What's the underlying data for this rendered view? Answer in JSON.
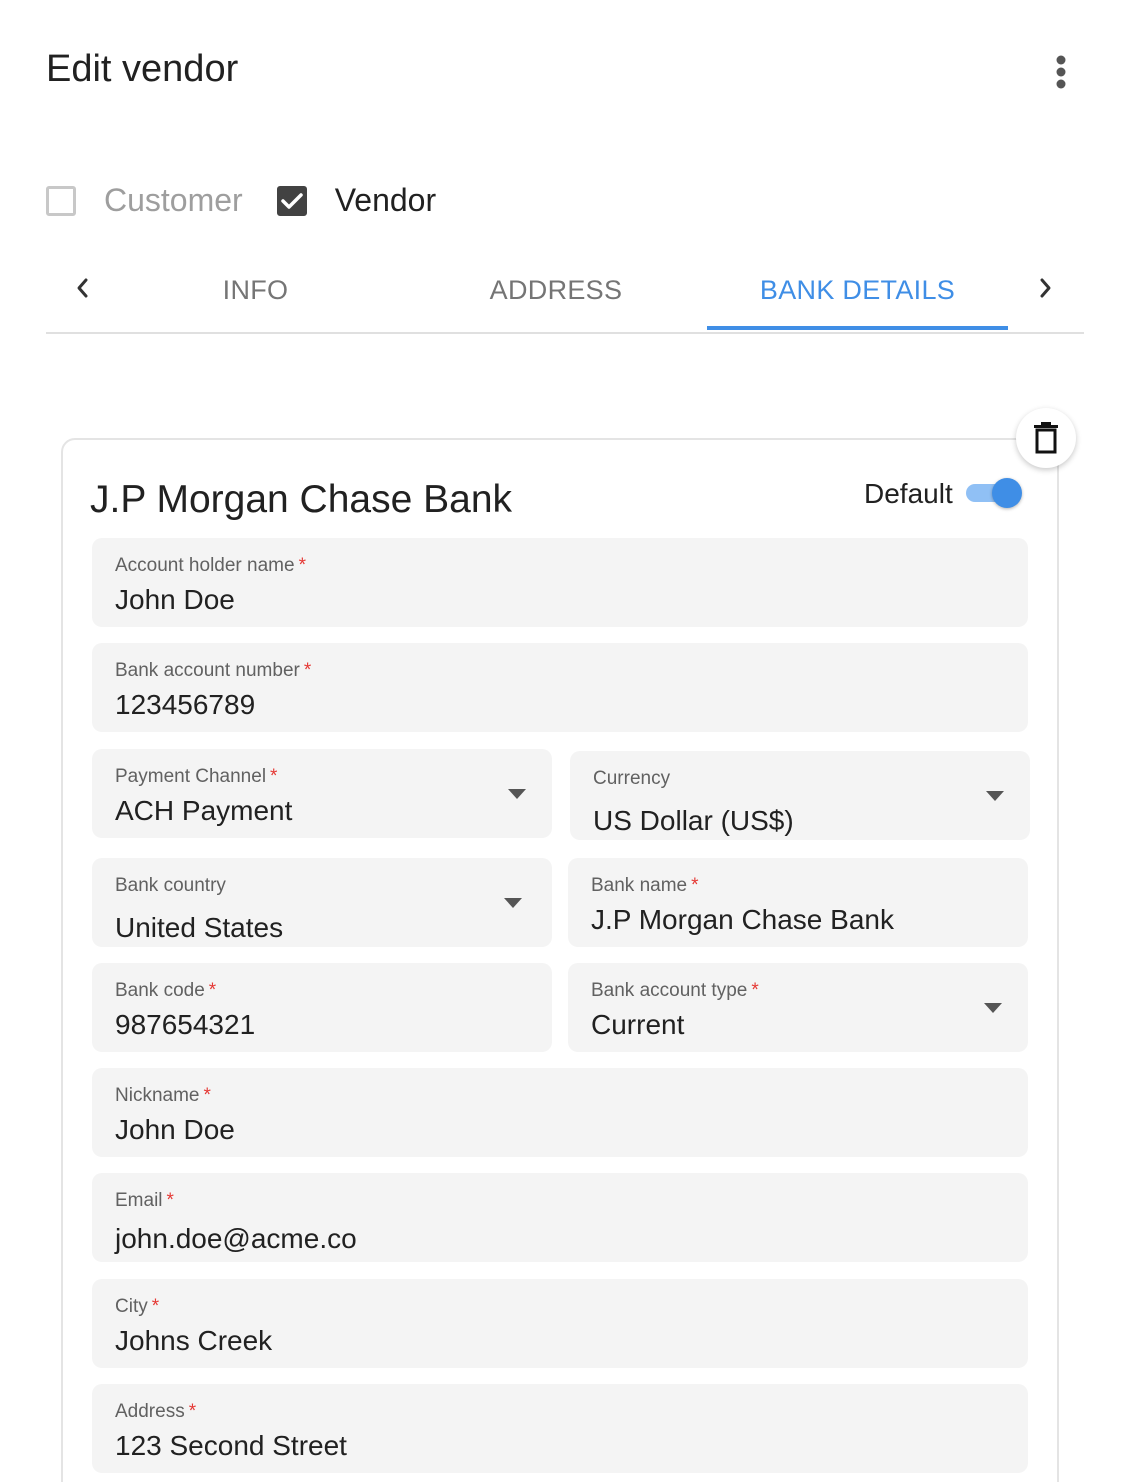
{
  "header": {
    "title": "Edit vendor",
    "more_icon": "more-vertical-icon"
  },
  "types": [
    {
      "label": "Customer",
      "checked": false
    },
    {
      "label": "Vendor",
      "checked": true
    }
  ],
  "tabs": [
    {
      "label": "INFO",
      "active": false
    },
    {
      "label": "ADDRESS",
      "active": false
    },
    {
      "label": "BANK DETAILS",
      "active": true
    }
  ],
  "card": {
    "title": "J.P Morgan Chase Bank",
    "default_label": "Default",
    "default_on": true,
    "delete_icon": "trash-icon"
  },
  "fields": {
    "account_holder_name": {
      "label": "Account holder name",
      "required": "*",
      "value": "John Doe"
    },
    "bank_account_number": {
      "label": "Bank account number",
      "required": "*",
      "value": "123456789"
    },
    "payment_channel": {
      "label": "Payment Channel",
      "required": "*",
      "value": "ACH Payment"
    },
    "currency": {
      "label": "Currency",
      "required": "",
      "value": "US Dollar (US$)"
    },
    "bank_country": {
      "label": "Bank country",
      "required": "",
      "value": "United States"
    },
    "bank_name": {
      "label": "Bank name",
      "required": "*",
      "value": "J.P Morgan Chase Bank"
    },
    "bank_code": {
      "label": "Bank code",
      "required": "*",
      "value": "987654321"
    },
    "bank_account_type": {
      "label": "Bank account type",
      "required": "*",
      "value": "Current"
    },
    "nickname": {
      "label": "Nickname",
      "required": "*",
      "value": "John Doe"
    },
    "email": {
      "label": "Email",
      "required": "*",
      "value": "john.doe@acme.co"
    },
    "city": {
      "label": "City",
      "required": "*",
      "value": "Johns Creek"
    },
    "address": {
      "label": "Address",
      "required": "*",
      "value": "123 Second Street"
    }
  },
  "colors": {
    "accent": "#3f8ee6",
    "required": "#e53935",
    "field_bg": "#f4f4f4"
  }
}
